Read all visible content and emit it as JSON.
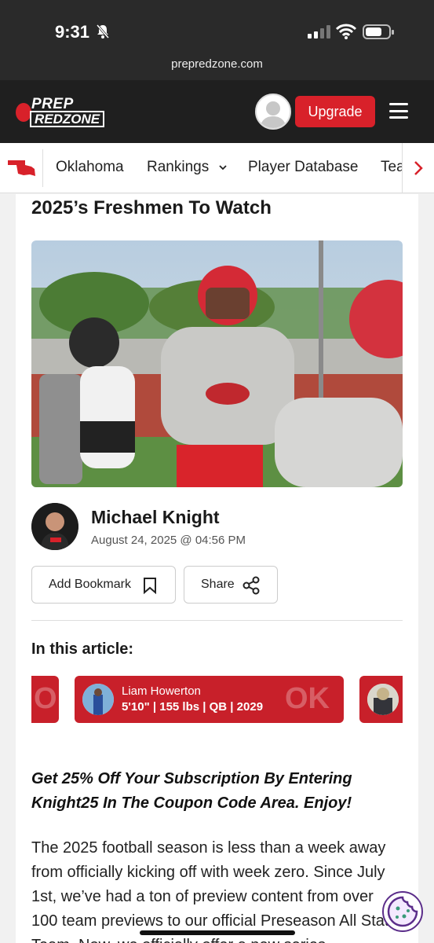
{
  "status_bar": {
    "time": "9:31",
    "url": "prepredzone.com",
    "icons": [
      "bell-slash-icon",
      "signal-icon",
      "wifi-icon",
      "battery-icon"
    ]
  },
  "header": {
    "logo_line1": "PREP",
    "logo_line2": "REDZONE",
    "upgrade_label": "Upgrade",
    "menu_icon": "hamburger-icon",
    "accent_color": "#d8212a"
  },
  "nav": {
    "state_icon": "oklahoma-state-icon",
    "items": [
      {
        "label": "Oklahoma"
      },
      {
        "label": "Rankings",
        "has_dropdown": true
      },
      {
        "label": "Player Database"
      },
      {
        "label": "Tea"
      }
    ],
    "scroll_icon": "chevron-right-icon"
  },
  "article": {
    "title": "2025’s Freshmen To Watch",
    "author": {
      "name": "Michael Knight",
      "date": "August 24, 2025 @ 04:56 PM"
    },
    "bookmark_label": "Add Bookmark",
    "share_label": "Share",
    "in_this_article": "In this article:",
    "players": [
      {
        "watermark": "OK"
      },
      {
        "name": "Liam Howerton",
        "info": "5'10\" | 155 lbs | QB | 2029",
        "watermark": "OK"
      },
      {
        "watermark": ""
      }
    ],
    "promo": "Get 25% Off Your Subscription By Entering Knight25 In The Coupon Code Area. Enjoy!",
    "body": "The 2025 football season is less than a week away from officially kicking off with week zero. Since July 1st, we’ve had a ton of preview content from over 100 team previews to our official Preseason All State Team. Now, we officially offer a new series"
  }
}
